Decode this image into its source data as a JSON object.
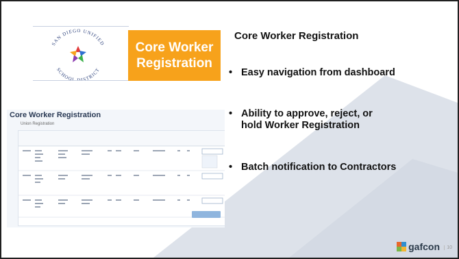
{
  "logo": {
    "text_top": "SAN DIEGO UNIFIED",
    "text_bottom": "SCHOOL DISTRICT"
  },
  "callout": {
    "line1": "Core Worker",
    "line2": "Registration"
  },
  "panel": {
    "title": "Core Worker Registration"
  },
  "bullets": [
    {
      "line1": "Easy navigation from dashboard",
      "line2": ""
    },
    {
      "line1": "Ability to approve, reject, or",
      "line2": "hold Worker Registration"
    },
    {
      "line1": "Batch notification to Contractors",
      "line2": ""
    }
  ],
  "bullet_glyph": "•",
  "screenshot": {
    "title": "Core Worker Registration",
    "subtitle": "Union Registration"
  },
  "footer": {
    "brand": "gafcon",
    "page": "10"
  },
  "colors": {
    "accent": "#f7a21b",
    "brand_text": "#2b3a4a",
    "shape": "#dde2ea"
  }
}
